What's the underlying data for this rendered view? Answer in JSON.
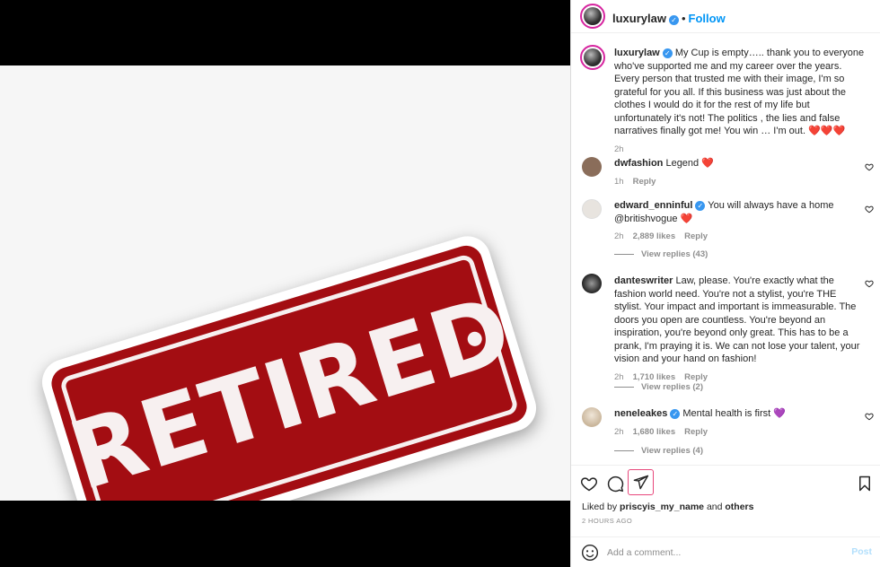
{
  "media": {
    "stamp_text": "RETIRED"
  },
  "header": {
    "username": "luxurylaw",
    "follow_label": "Follow",
    "separator": "•"
  },
  "caption": {
    "username": "luxurylaw",
    "text": "My Cup is empty….. thank you to everyone who've supported me and my career over the years. Every person that trusted me with their image, I'm so grateful for you all. If this business was just about the clothes I would do it for the rest of my life but unfortunately it's not! The politics , the lies and false narratives finally got me! You win … I'm out. ❤️❤️❤️",
    "time": "2h"
  },
  "comments": [
    {
      "username": "dwfashion",
      "verified": false,
      "text": "Legend ❤️",
      "time": "1h",
      "likes": "",
      "reply_label": "Reply",
      "view_replies": ""
    },
    {
      "username": "edward_enninful",
      "verified": true,
      "text": "You will always have a home @britishvogue ❤️",
      "time": "2h",
      "likes": "2,889 likes",
      "reply_label": "Reply",
      "view_replies": "View replies (43)"
    },
    {
      "username": "danteswriter",
      "verified": false,
      "text": "Law, please. You're exactly what the fashion world need. You're not a stylist, you're THE stylist. Your impact and important is immeasurable. The doors you open are countless. You're beyond an inspiration, you're beyond only great. This has to be a prank, I'm praying it is. We can not lose your talent, your vision and your hand on fashion!",
      "time": "2h",
      "likes": "1,710 likes",
      "reply_label": "Reply",
      "view_replies": "View replies (2)"
    },
    {
      "username": "neneleakes",
      "verified": true,
      "text": "Mental health is first 💜",
      "time": "2h",
      "likes": "1,680 likes",
      "reply_label": "Reply",
      "view_replies": "View replies (4)"
    }
  ],
  "footer": {
    "liked_prefix": "Liked by",
    "liked_user": "priscyis_my_name",
    "liked_and": "and",
    "liked_others": "others",
    "ago": "2 HOURS AGO",
    "comment_placeholder": "Add a comment...",
    "post_label": "Post"
  },
  "colors": {
    "accent": "#0095f6",
    "verified": "#3897f0",
    "stamp": "#a30d12"
  }
}
